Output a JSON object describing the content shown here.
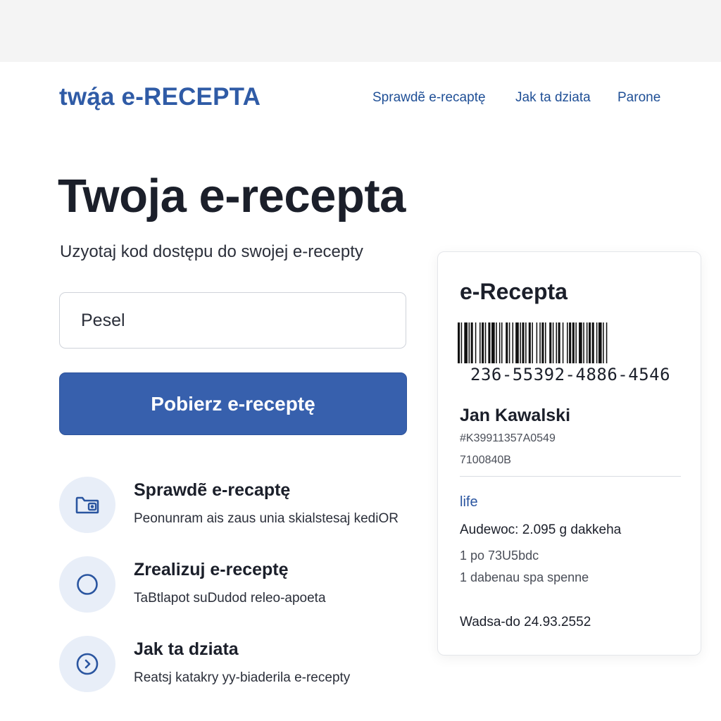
{
  "header": {
    "logo": "twą́a e-RECEPTA",
    "nav": [
      {
        "label": "Sprawdẽ e-recaptę"
      },
      {
        "label": "Jak ta dziata"
      },
      {
        "label": "Parone"
      }
    ]
  },
  "hero": {
    "title": "Twoja e-recepta",
    "subtitle": "Uzyotaj kod dostępu do swojej e-recepty",
    "input_placeholder": "Pesel",
    "button_label": "Pobierz e-receptę"
  },
  "features": [
    {
      "icon": "wallet-icon",
      "title": "Sprawdẽ e-recaptę",
      "description": "Peonunram ais zaus  unia skialstesaj kediOR"
    },
    {
      "icon": "circle-icon",
      "title": "Zrealizuj e-receptę",
      "description": "TaBtlapot suDudod releo-apoeta"
    },
    {
      "icon": "arrow-circle-icon",
      "title": "Jak ta dziata",
      "description": "Reatsj katakry yy-biaderila e-recepty"
    }
  ],
  "card": {
    "title": "e-Recepta",
    "barcode_number": "236-55392-4886-4546",
    "patient_name": "Jan Kawalski",
    "patient_id": "#K39911357A0549",
    "patient_code": "7100840B",
    "section_label": "life",
    "drug": "Audewoc: 2.095 g dakkeha",
    "dose": "1 po 73U5bdc",
    "package": "1 dabenau spa spenne",
    "valid_until": "Wadsa-do 24.93.2552"
  },
  "colors": {
    "accent": "#3760ad",
    "logo": "#2f5ba6",
    "icon_bg": "#e8eef8",
    "top_strip": "#f4f4f4"
  }
}
